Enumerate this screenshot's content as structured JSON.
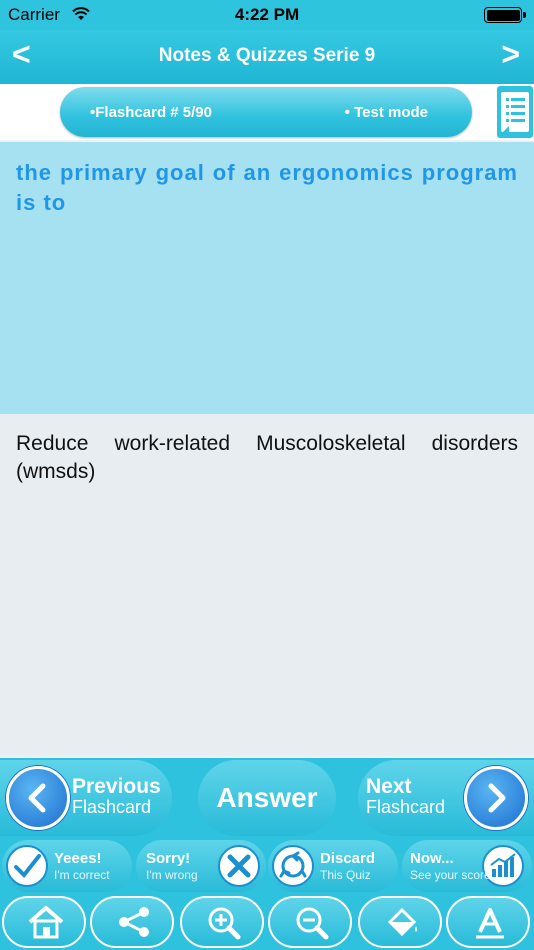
{
  "status": {
    "carrier": "Carrier",
    "time": "4:22 PM"
  },
  "nav": {
    "title": "Notes & Quizzes Serie 9",
    "back_label": "<",
    "forward_label": ">"
  },
  "info": {
    "flashcard": "•Flashcard #  5/90",
    "mode": "• Test mode"
  },
  "question": "the primary goal of an ergonomics program is to",
  "answer": "Reduce work-related Muscoloskeletal disorders (wmsds)",
  "controls": {
    "previous_big": "Previous",
    "previous_small": "Flashcard",
    "answer": "Answer",
    "next_big": "Next",
    "next_small": "Flashcard"
  },
  "score": {
    "yes_big": "Yeees!",
    "yes_small": "I'm correct",
    "sorry_big": "Sorry!",
    "sorry_small": "I'm wrong",
    "discard_big": "Discard",
    "discard_small": "This Quiz",
    "now_big": "Now...",
    "now_small": "See your score"
  },
  "toolbar": [
    "home-icon",
    "share-icon",
    "zoom-in-icon",
    "zoom-out-icon",
    "fill-color-icon",
    "font-icon"
  ],
  "colors": {
    "accent": "#2fc2de",
    "question_bg": "#a6e1f2",
    "question_text": "#2196e6",
    "answer_bg": "#e8edf1",
    "circle_blue": "#1c6ed0"
  }
}
